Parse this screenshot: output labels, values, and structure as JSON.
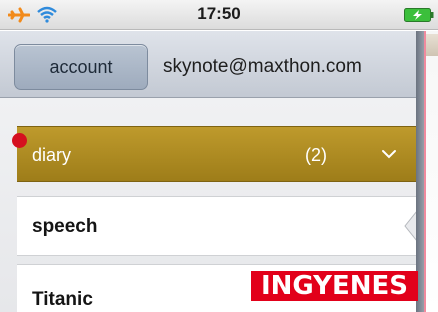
{
  "status_bar": {
    "time": "17:50",
    "icons": [
      "airplane-icon",
      "wifi-icon",
      "battery-charging-icon"
    ]
  },
  "account_bar": {
    "account_button_label": "account",
    "email": "skynote@maxthon.com"
  },
  "notebooks": [
    {
      "label": "diary",
      "count": "(2)",
      "selected": true
    },
    {
      "label": "speech"
    },
    {
      "label": "Titanic"
    }
  ],
  "badge": {
    "text": "INGYENES"
  },
  "colors": {
    "accent_gold": "#b08d23",
    "status_orange": "#f28a1a",
    "wifi_blue": "#2f8bdc",
    "battery_green": "#3bbf3b",
    "badge_red": "#e2001a"
  }
}
